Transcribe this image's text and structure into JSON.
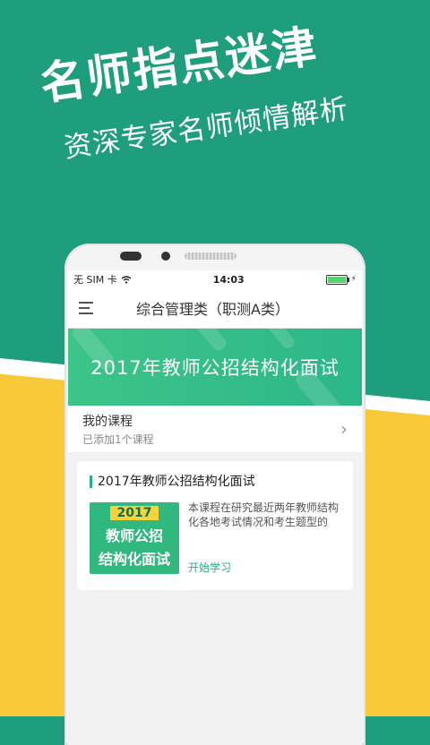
{
  "promo": {
    "headline": "名师指点迷津",
    "subline": "资深专家名师倾情解析"
  },
  "status_bar": {
    "carrier": "无 SIM 卡",
    "time": "14:03"
  },
  "nav": {
    "title": "综合管理类（职测A类）"
  },
  "banner": {
    "title": "2017年教师公招结构化面试"
  },
  "my_courses": {
    "title": "我的课程",
    "subtitle": "已添加1个课程"
  },
  "course_card": {
    "title": "2017年教师公招结构化面试",
    "thumb_year": "2017",
    "thumb_line1": "教师公招",
    "thumb_line2": "结构化面试",
    "description": "本课程在研究最近两年教师结构化各地考试情况和考生题型的",
    "action": "开始学习"
  },
  "colors": {
    "green": "#1f9e7d",
    "yellow": "#f7c938",
    "accent": "#29b07f"
  }
}
